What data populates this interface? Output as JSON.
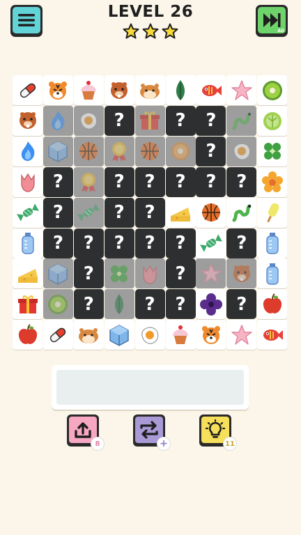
{
  "header": {
    "level_title": "LEVEL 26",
    "stars": 3,
    "menu_icon": "hamburger-menu-icon",
    "skip_icon": "fast-forward-icon",
    "skip_ad_tag": "AD"
  },
  "board": {
    "rows": 9,
    "cols": 9,
    "hidden_mark": "?",
    "tiles": [
      [
        "pill",
        "tiger",
        "cupcake",
        "beaver",
        "hamster",
        "leaf",
        "fish",
        "starfish",
        "kiwi"
      ],
      [
        "beaver",
        "fire-dim",
        "egg-dim",
        "hidden",
        "gift-dim",
        "hidden",
        "hidden",
        "worm-dim",
        "lettuce"
      ],
      [
        "fire",
        "ice-dim",
        "ball-dim",
        "medal-dim",
        "ball-dim",
        "donut-dim",
        "hidden",
        "egg-dim",
        "clover"
      ],
      [
        "tulip",
        "hidden",
        "medal-dim",
        "hidden",
        "hidden",
        "hidden",
        "hidden",
        "hidden",
        "flower"
      ],
      [
        "candy",
        "hidden",
        "candy-dim",
        "hidden",
        "hidden",
        "cheese",
        "ball",
        "worm",
        "popsicle"
      ],
      [
        "bottle",
        "hidden",
        "hidden",
        "hidden",
        "hidden",
        "hidden",
        "candy",
        "hidden",
        "bottle"
      ],
      [
        "cheese",
        "ice-dim",
        "hidden",
        "clover-dim",
        "tulip-dim",
        "hidden",
        "starfish-dim",
        "beaver-dim",
        "bottle"
      ],
      [
        "gift",
        "kiwi-dim",
        "hidden",
        "leaf-dim",
        "hidden",
        "hidden",
        "violet",
        "hidden",
        "apple"
      ],
      [
        "apple",
        "pill",
        "hamster",
        "ice",
        "egg",
        "cupcake",
        "tiger",
        "starfish",
        "fish"
      ]
    ]
  },
  "tools": [
    {
      "name": "undo",
      "icon": "upload-arrow-icon",
      "count": "8",
      "color": "#f7a7c2",
      "badge_color": "#e47fa4"
    },
    {
      "name": "shuffle",
      "icon": "shuffle-arrows-icon",
      "count": "+",
      "color": "#a99ad6",
      "badge_color": "#8f7bc9"
    },
    {
      "name": "hint",
      "icon": "lightbulb-icon",
      "count": "11",
      "color": "#f6df5a",
      "badge_color": "#c9a52a"
    }
  ]
}
